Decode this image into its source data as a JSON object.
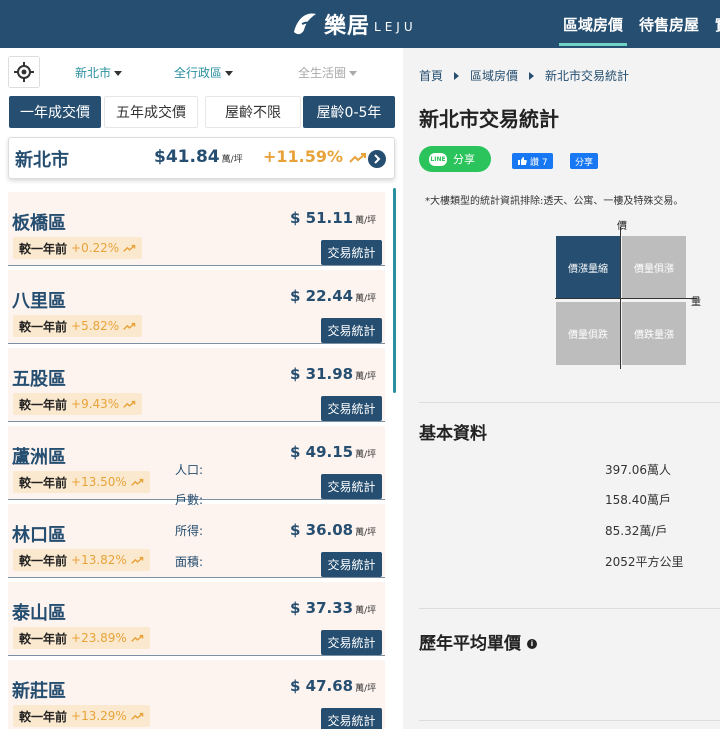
{
  "header": {
    "logo_text": "樂居",
    "logo_sub": "LEJU",
    "nav": [
      "區域房價",
      "待售房屋",
      "實"
    ]
  },
  "filters": {
    "city": "新北市",
    "district": "全行政區",
    "life_circle": "全生活圈",
    "segments": [
      "一年成交價",
      "五年成交價",
      "屋齡不限",
      "屋齡0-5年"
    ]
  },
  "city_summary": {
    "name": "新北市",
    "price": "$41.84",
    "unit": "萬/坪",
    "change": "+11.59%"
  },
  "districts": [
    {
      "name": "板橋區",
      "price": "$ 51.11",
      "unit": "萬/坪",
      "cmp_label": "較一年前",
      "change": "+0.22%",
      "btn": "交易統計"
    },
    {
      "name": "八里區",
      "price": "$ 22.44",
      "unit": "萬/坪",
      "cmp_label": "較一年前",
      "change": "+5.82%",
      "btn": "交易統計"
    },
    {
      "name": "五股區",
      "price": "$ 31.98",
      "unit": "萬/坪",
      "cmp_label": "較一年前",
      "change": "+9.43%",
      "btn": "交易統計"
    },
    {
      "name": "蘆洲區",
      "price": "$ 49.15",
      "unit": "萬/坪",
      "cmp_label": "較一年前",
      "change": "+13.50%",
      "btn": "交易統計"
    },
    {
      "name": "林口區",
      "price": "$ 36.08",
      "unit": "萬/坪",
      "cmp_label": "較一年前",
      "change": "+13.82%",
      "btn": "交易統計"
    },
    {
      "name": "泰山區",
      "price": "$ 37.33",
      "unit": "萬/坪",
      "cmp_label": "較一年前",
      "change": "+23.89%",
      "btn": "交易統計"
    },
    {
      "name": "新莊區",
      "price": "$ 47.68",
      "unit": "萬/坪",
      "cmp_label": "較一年前",
      "change": "+13.29%",
      "btn": "交易統計"
    }
  ],
  "breadcrumb": [
    "首頁",
    "區域房價",
    "新北市交易統計"
  ],
  "right_title": "新北市交易統計",
  "share": {
    "line_logo": "LINE",
    "line": "分享",
    "fb_like": "讚 7",
    "fb_share": "分享"
  },
  "note": "*大樓類型的統計資訊排除:透天、公寓、一樓及特殊交易。",
  "quadrant": {
    "y_label": "價",
    "x_label": "量",
    "cells": [
      "價漲量縮",
      "價量俱漲",
      "價量俱跌",
      "價跌量漲"
    ]
  },
  "basic_info": {
    "title": "基本資料",
    "items": [
      {
        "k": "人口:",
        "v": "397.06萬人"
      },
      {
        "k": "戶數:",
        "v": "158.40萬戶"
      },
      {
        "k": "所得:",
        "v": "85.32萬/戶"
      },
      {
        "k": "面積:",
        "v": "2052平方公里"
      }
    ]
  },
  "yearly_title": "歷年平均單價",
  "colors": {
    "primary": "#254e70",
    "accent_up": "#e7a33a",
    "row_bg": "#fdf3ef",
    "line_green": "#2ac35c",
    "fb_blue": "#1877f2"
  }
}
